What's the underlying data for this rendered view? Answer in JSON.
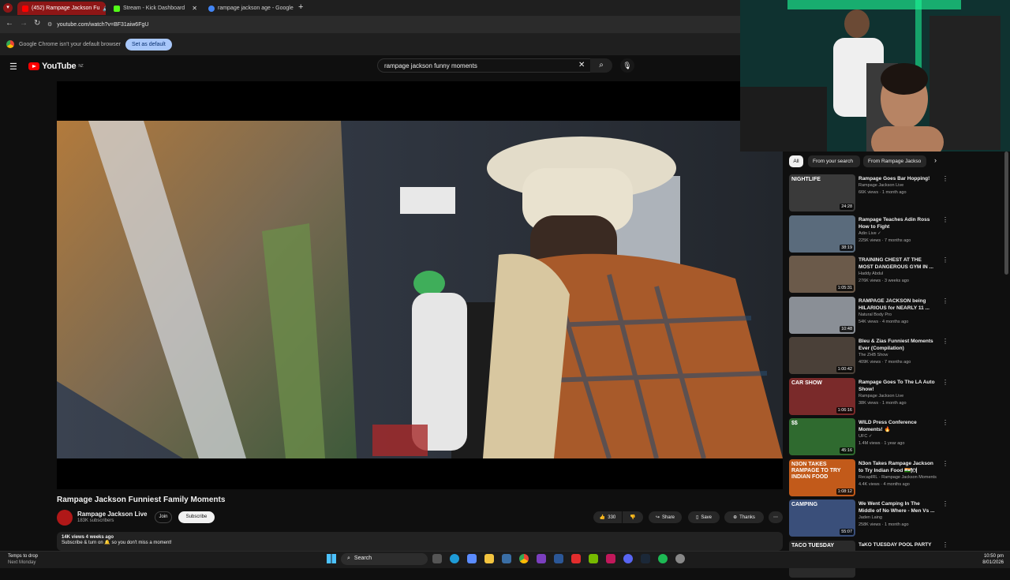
{
  "browser": {
    "tabs": [
      {
        "label": "(452) Rampage Jackson Fu",
        "active": true,
        "icon_color": "#ff0000"
      },
      {
        "label": "Stream - Kick Dashboard",
        "active": false,
        "icon_color": "#53fc18"
      },
      {
        "label": "rampage jackson age - Google",
        "active": false,
        "icon_color": "#4285f4"
      }
    ],
    "url": "youtube.com/watch?v=BF31aiw6FgU",
    "infobar": {
      "message": "Google Chrome isn't your default browser",
      "button": "Set as default"
    }
  },
  "youtube": {
    "logo_text": "YouTube",
    "region": "NZ",
    "search_query": "rampage jackson funny moments",
    "video": {
      "title": "Rampage Jackson Funniest Family Moments",
      "channel": "Rampage Jackson Live",
      "subscribers": "183K subscribers",
      "join_label": "Join",
      "subscribe_label": "Subscribe",
      "likes": "330",
      "share_label": "Share",
      "save_label": "Save",
      "thanks_label": "Thanks",
      "views_date": "14K views  4 weeks ago",
      "description": "Subscribe & turn on 🔔 so you don't miss a moment!"
    },
    "chips": [
      "All",
      "From your search",
      "From Rampage Jackso"
    ],
    "recommendations": [
      {
        "title": "Rampage Goes Bar Hopping!",
        "channel": "Rampage Jackson Live",
        "meta": "66K views · 1 month ago",
        "duration": "24:28",
        "color": "#3a3a3a",
        "thumb_text": "NIGHTLIFE"
      },
      {
        "title": "Rampage Teaches Adin Ross How to Fight",
        "channel": "Adin Live ✓",
        "meta": "225K views · 7 months ago",
        "duration": "38:19",
        "color": "#5a6b7c",
        "thumb_text": ""
      },
      {
        "title": "TRAINING CHEST AT THE MOST DANGEROUS GYM IN ...",
        "channel": "Haddy Abdul",
        "meta": "276K views · 3 weeks ago",
        "duration": "1:05:31",
        "color": "#6b5a4a",
        "thumb_text": ""
      },
      {
        "title": "RAMPAGE JACKSON being HILARIOUS for NEARLY 11 ...",
        "channel": "Natural Body Pro",
        "meta": "54K views · 4 months ago",
        "duration": "10:48",
        "color": "#8a8f96",
        "thumb_text": ""
      },
      {
        "title": "Bleu & Zias Funniest Moments Ever (Compilation)",
        "channel": "The ZHB Show",
        "meta": "409K views · 7 months ago",
        "duration": "1:00:42",
        "color": "#4a4038",
        "thumb_text": ""
      },
      {
        "title": "Rampage Goes To The LA Auto Show!",
        "channel": "Rampage Jackson Live",
        "meta": "38K views · 1 month ago",
        "duration": "1:06:16",
        "color": "#7a2a2a",
        "thumb_text": "CAR SHOW"
      },
      {
        "title": "WILD Press Conference Moments! 🔥",
        "channel": "UFC ✓",
        "meta": "1.4M views · 1 year ago",
        "duration": "45:16",
        "color": "#2f6a2f",
        "thumb_text": "$$"
      },
      {
        "title": "N3on Takes Rampage Jackson to Try Indian Food 🇮🇳🍽",
        "channel": "RecapIRL - Rampage Jackson Moments",
        "meta": "4.4K views · 4 months ago",
        "duration": "1:08:12",
        "color": "#c25a1a",
        "thumb_text": "N3ON TAKES RAMPAGE TO TRY INDIAN FOOD"
      },
      {
        "title": "We Went Camping In The Middle of No Where - Men Vs ...",
        "channel": "Jaden Laing",
        "meta": "258K views · 1 month ago",
        "duration": "55:07",
        "color": "#3a4f7a",
        "thumb_text": "CAMPING"
      },
      {
        "title": "TaKO TUESDAY POOL PARTY",
        "channel": "",
        "meta": "",
        "duration": "",
        "color": "#2a2a2a",
        "thumb_text": "TACO TUESDAY"
      }
    ]
  },
  "taskbar": {
    "weather": "Temps to drop",
    "weather_sub": "Next Monday",
    "search": "Search",
    "time": "10:50 pm",
    "date": "8/01/2026"
  }
}
